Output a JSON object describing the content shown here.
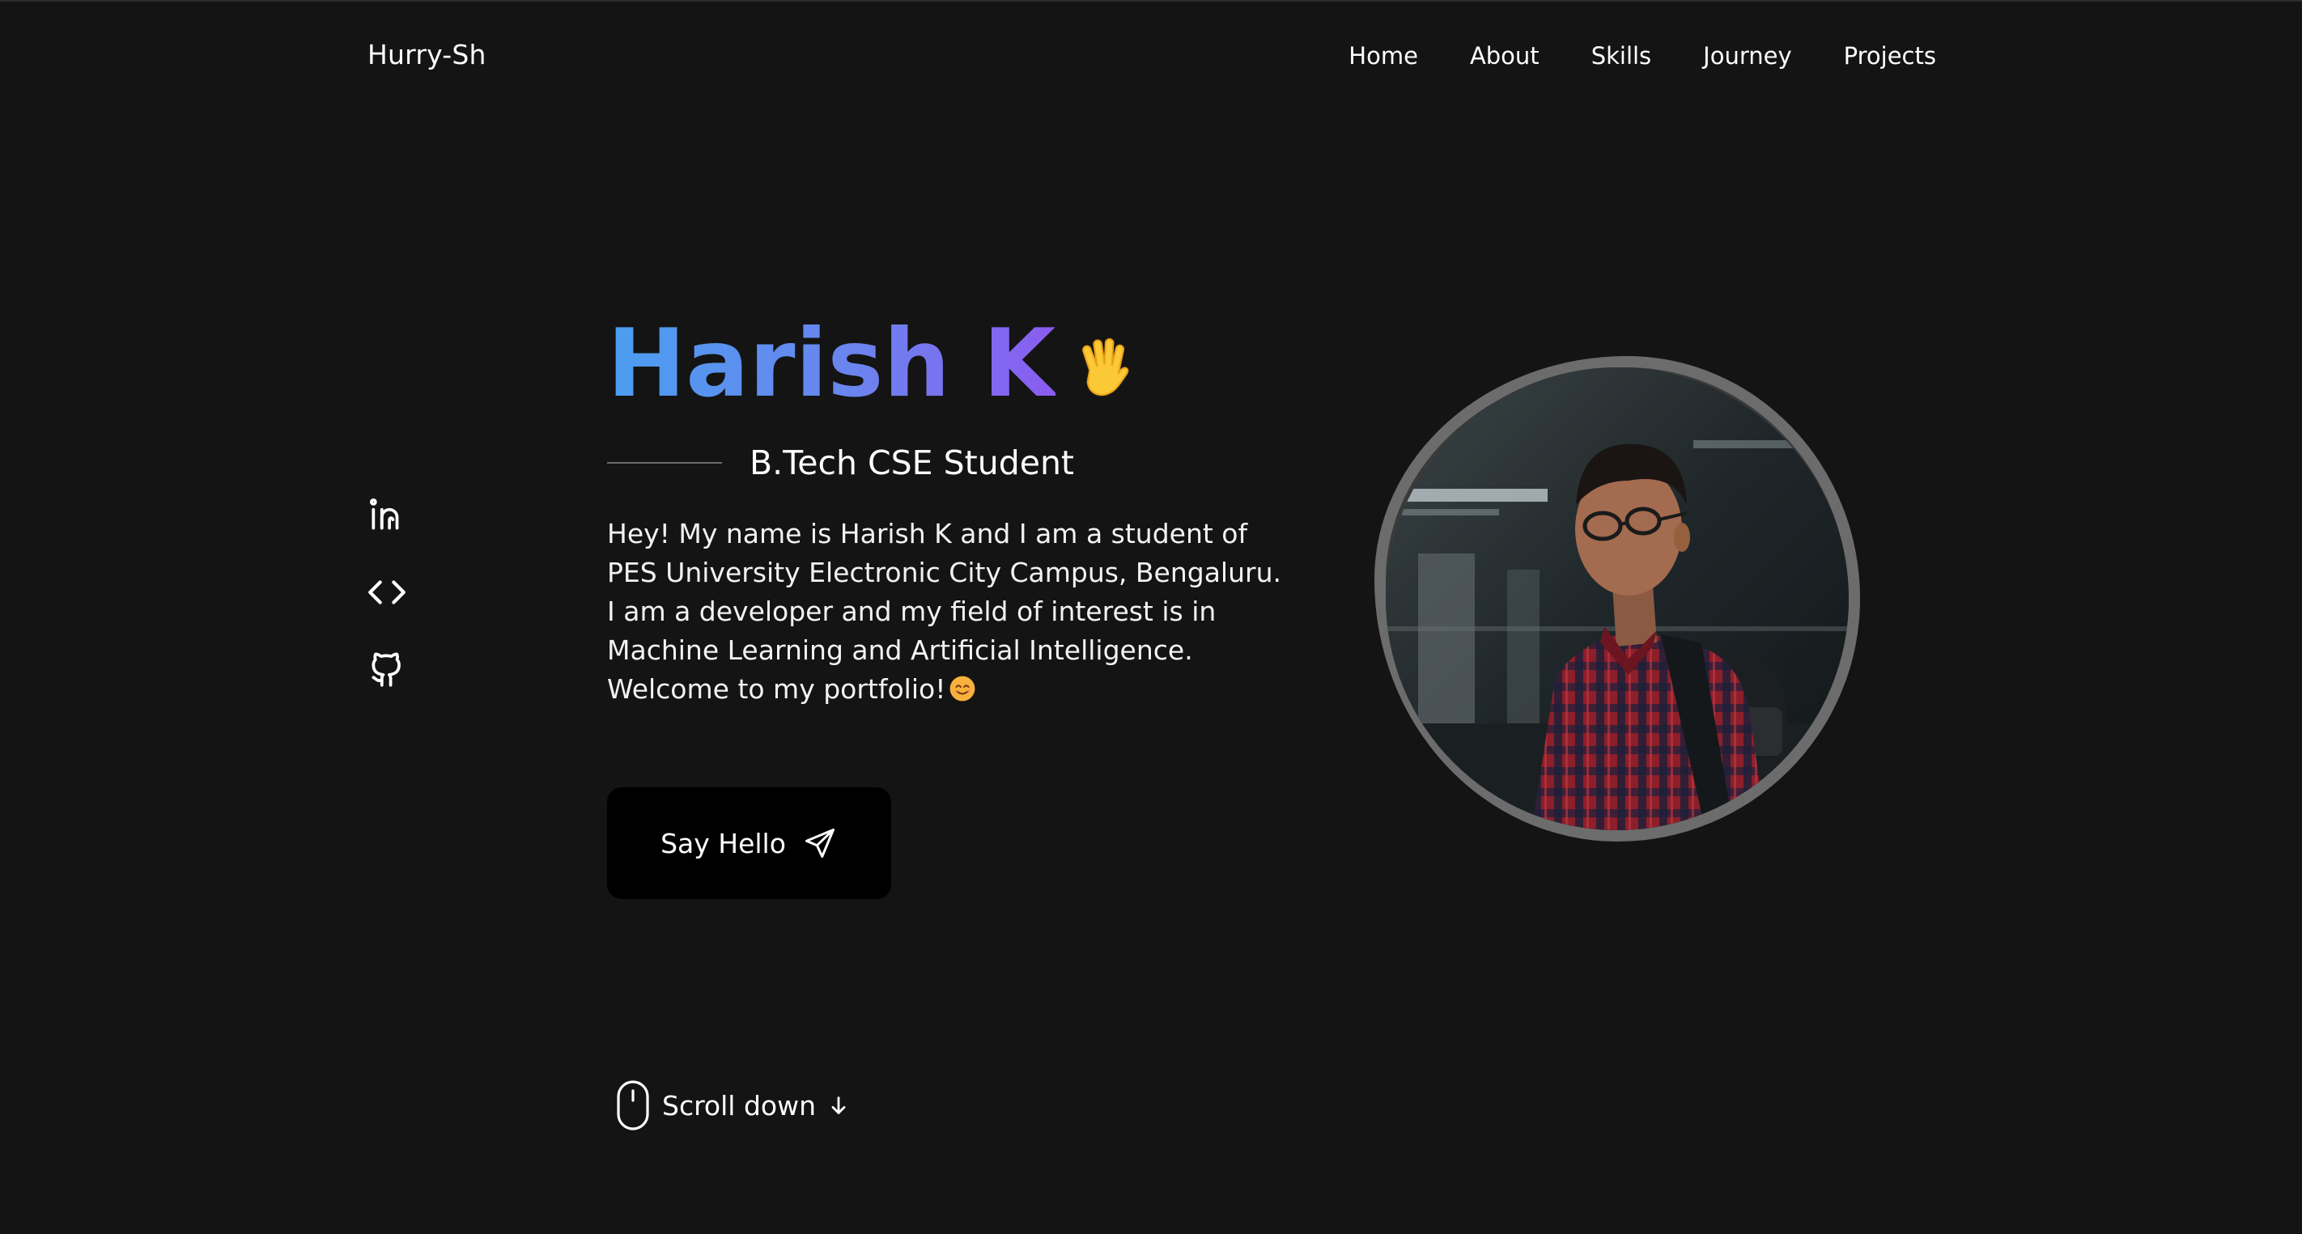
{
  "header": {
    "logo": "Hurry-Sh",
    "nav": [
      "Home",
      "About",
      "Skills",
      "Journey",
      "Projects"
    ]
  },
  "socials": [
    {
      "icon": "linkedin-icon"
    },
    {
      "icon": "code-icon"
    },
    {
      "icon": "github-icon"
    }
  ],
  "hero": {
    "name": "Harish K",
    "subtitle": "B.Tech CSE Student",
    "bio_lines": [
      "Hey! My name is Harish K and I am a student of",
      "PES University Electronic City Campus, Bengaluru.",
      "I am a developer and my field of interest is in",
      "Machine Learning and Artificial Intelligence.",
      "Welcome to my portfolio!"
    ],
    "cta_label": "Say Hello",
    "scroll_label": "Scroll down"
  },
  "colors": {
    "background": "#141414",
    "gradient_start": "#4a9ef0",
    "gradient_end": "#8a5cf0",
    "button": "#000000"
  }
}
